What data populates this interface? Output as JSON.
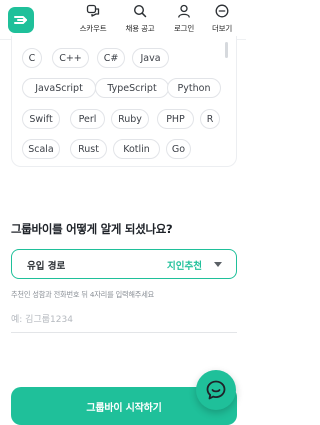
{
  "app": {
    "brand_color": "#1fc09a"
  },
  "header": {
    "logo": {
      "icon": "grouby-logo-icon"
    },
    "nav": [
      {
        "label": "스카우트",
        "icon": "scout-chat-icon"
      },
      {
        "label": "채용 공고",
        "icon": "search-icon"
      },
      {
        "label": "로그인",
        "icon": "user-icon"
      },
      {
        "label": "더보기",
        "icon": "more-icon"
      }
    ]
  },
  "skills": {
    "tags": [
      "C",
      "C++",
      "C#",
      "Java",
      "JavaScript",
      "TypeScript",
      "Python",
      "Swift",
      "Perl",
      "Ruby",
      "PHP",
      "R",
      "Scala",
      "Rust",
      "Kotlin",
      "Go"
    ]
  },
  "referral": {
    "question": "그룹바이를 어떻게 알게 되셨나요?",
    "select_label": "유입 경로",
    "select_value": "지인추천",
    "hint": "추천인 성함과 전화번호 뒤 4자리를 입력해주세요",
    "input_placeholder": "예: 김그룹1234",
    "input_value": ""
  },
  "cta": {
    "label": "그룹바이 시작하기"
  },
  "chat": {
    "icon": "chat-icon"
  }
}
